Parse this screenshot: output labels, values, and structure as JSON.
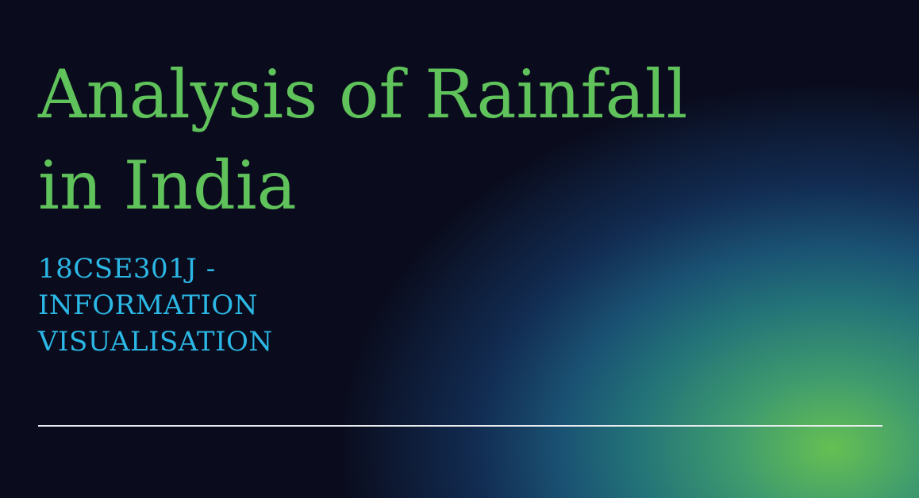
{
  "slide": {
    "title_line1": "Analysis of Rainfall",
    "title_line2": "in India",
    "subtitle_line1": "18CSE301J -",
    "subtitle_line2": "INFORMATION",
    "subtitle_line3": "VISUALISATION"
  },
  "colors": {
    "background": "#0a0c1d",
    "title": "#5fc25a",
    "subtitle": "#2cb8e6",
    "divider": "#e8ecef",
    "glow_center": "#66c053",
    "glow_mid": "#237378"
  }
}
